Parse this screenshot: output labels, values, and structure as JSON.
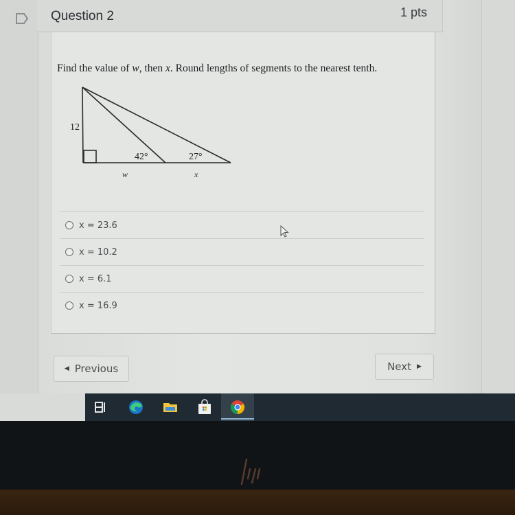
{
  "question": {
    "title": "Question 2",
    "points": "1 pts",
    "prompt_parts": [
      "Find the value of ",
      "w",
      ", then ",
      "x",
      ". Round lengths of segments to the nearest tenth."
    ],
    "diagram": {
      "side_label": "12",
      "angle_1": "42°",
      "angle_2": "27°",
      "segment_1": "w",
      "segment_2": "x"
    },
    "answers": [
      {
        "label": "x = 23.6",
        "selected": false
      },
      {
        "label": "x = 10.2",
        "selected": false
      },
      {
        "label": "x = 6.1",
        "selected": false
      },
      {
        "label": "x = 16.9",
        "selected": false
      }
    ]
  },
  "navigation": {
    "previous_label": "Previous",
    "next_label": "Next"
  },
  "taskbar": {
    "icons": [
      "task-view-icon",
      "edge-icon",
      "file-explorer-icon",
      "store-icon",
      "chrome-icon"
    ],
    "active": "chrome-icon"
  },
  "bezel": {
    "logo": "hp-logo"
  }
}
